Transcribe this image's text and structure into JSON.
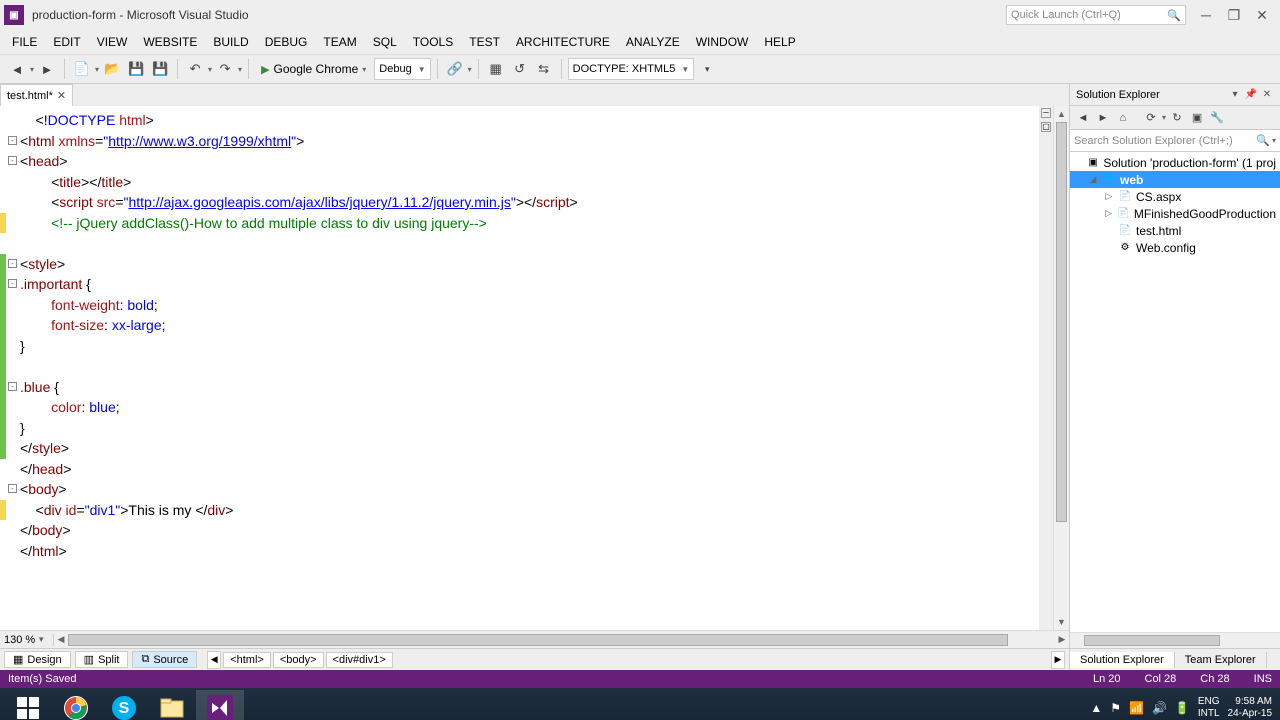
{
  "window": {
    "title": "production-form - Microsoft Visual Studio",
    "quick_launch_placeholder": "Quick Launch (Ctrl+Q)"
  },
  "menu": [
    "FILE",
    "EDIT",
    "VIEW",
    "WEBSITE",
    "BUILD",
    "DEBUG",
    "TEAM",
    "SQL",
    "TOOLS",
    "TEST",
    "ARCHITECTURE",
    "ANALYZE",
    "WINDOW",
    "HELP"
  ],
  "toolbar": {
    "start_label": "Google Chrome",
    "config": "Debug",
    "doctype": "DOCTYPE: XHTML5"
  },
  "tab": {
    "name": "test.html*",
    "dirty": true
  },
  "code_lines": [
    {
      "indent": 1,
      "html": "&lt;!<span class='kw-blue'>DOCTYPE</span> <span class='kw-red'>html</span>&gt;"
    },
    {
      "indent": 0,
      "outline": "-",
      "html": "&lt;<span class='kw-maroon'>html</span> <span class='kw-red'>xmlns</span>=<span class='kw-blue'>\"</span><span class='kw-link'>http://www.w3.org/1999/xhtml</span><span class='kw-blue'>\"</span>&gt;"
    },
    {
      "indent": 0,
      "outline": "-",
      "html": "&lt;<span class='kw-maroon'>head</span>&gt;"
    },
    {
      "indent": 2,
      "html": "&lt;<span class='kw-maroon'>title</span>&gt;&lt;/<span class='kw-maroon'>title</span>&gt;"
    },
    {
      "indent": 2,
      "html": "&lt;<span class='kw-maroon'>script</span> <span class='kw-red'>src</span>=<span class='kw-blue'>\"</span><span class='kw-link'>http://ajax.googleapis.com/ajax/libs/jquery/1.11.2/jquery.min.js</span><span class='kw-blue'>\"</span>&gt;&lt;/<span class='kw-maroon'>script</span>&gt;"
    },
    {
      "indent": 2,
      "change": "yellow",
      "html": "<span class='kw-green'>&lt;!-- jQuery addClass()-How to add multiple class to div using jquery--&gt;</span>"
    },
    {
      "indent": 0,
      "html": ""
    },
    {
      "indent": 0,
      "outline": "-",
      "change": "green",
      "html": "&lt;<span class='kw-maroon'>style</span>&gt;"
    },
    {
      "indent": 0,
      "outline": "-",
      "change": "green",
      "html": "<span class='kw-maroon'>.important</span> {"
    },
    {
      "indent": 2,
      "change": "green",
      "html": "<span class='kw-red'>font-weight</span>: <span class='kw-blue'>bold</span>;"
    },
    {
      "indent": 2,
      "change": "green",
      "html": "<span class='kw-red'>font-size</span>: <span class='kw-blue'>xx-large</span>;"
    },
    {
      "indent": 0,
      "change": "green",
      "html": "}"
    },
    {
      "indent": 0,
      "change": "green",
      "html": ""
    },
    {
      "indent": 0,
      "outline": "-",
      "change": "green",
      "html": "<span class='kw-maroon'>.blue</span> {"
    },
    {
      "indent": 2,
      "change": "green",
      "html": "<span class='kw-red'>color</span>: <span class='kw-blue'>blue</span>;"
    },
    {
      "indent": 0,
      "change": "green",
      "html": "}"
    },
    {
      "indent": 0,
      "change": "green",
      "html": "&lt;/<span class='kw-maroon'>style</span>&gt;"
    },
    {
      "indent": 0,
      "html": "&lt;/<span class='kw-maroon'>head</span>&gt;"
    },
    {
      "indent": 0,
      "outline": "-",
      "html": "&lt;<span class='kw-maroon'>body</span>&gt;"
    },
    {
      "indent": 1,
      "change": "yellow",
      "html": "&lt;<span class='kw-maroon'>div</span> <span class='kw-red'>id</span>=<span class='kw-blue'>\"div1\"</span>&gt;This is my &lt;/<span class='kw-maroon'>div</span>&gt;"
    },
    {
      "indent": 0,
      "html": "&lt;/<span class='kw-maroon'>body</span>&gt;"
    },
    {
      "indent": 0,
      "html": "&lt;/<span class='kw-maroon'>html</span>&gt;"
    }
  ],
  "zoom": "130 %",
  "views": {
    "design": "Design",
    "split": "Split",
    "source": "Source"
  },
  "breadcrumb": [
    "<html>",
    "<body>",
    "<div#div1>"
  ],
  "solution_explorer": {
    "title": "Solution Explorer",
    "search_placeholder": "Search Solution Explorer (Ctrl+;)",
    "solution": "Solution 'production-form' (1 proj",
    "project": "web",
    "items": [
      "CS.aspx",
      "MFinishedGoodProduction",
      "test.html",
      "Web.config"
    ]
  },
  "bottom_tabs": [
    "Solution Explorer",
    "Team Explorer"
  ],
  "status": {
    "message": "Item(s) Saved",
    "ln": "Ln 20",
    "col": "Col 28",
    "ch": "Ch 28",
    "ins": "INS"
  },
  "tray": {
    "lang1": "ENG",
    "lang2": "INTL",
    "time": "9:58 AM",
    "date": "24-Apr-15"
  }
}
